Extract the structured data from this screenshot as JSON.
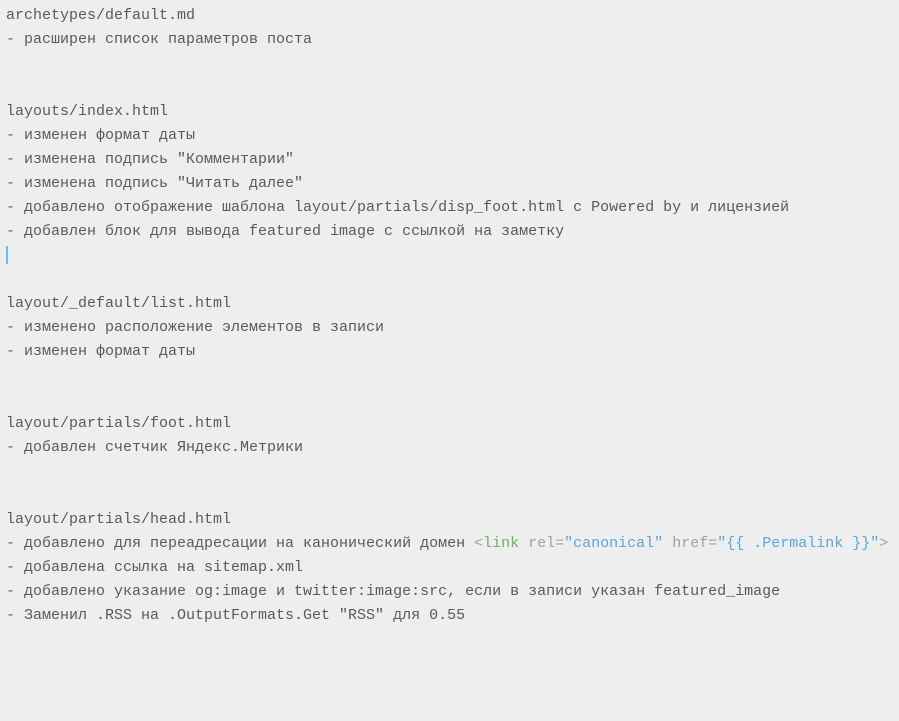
{
  "sections": [
    {
      "header": "archetypes/default.md",
      "items": [
        "- расширен список параметров поста"
      ]
    },
    {
      "header": "layouts/index.html",
      "items": [
        "- изменен формат даты",
        "- изменена подпись \"Комментарии\"",
        "- изменена подпись \"Читать далее\"",
        "- добавлено отображение шаблона layout/partials/disp_foot.html с Powered by и лицензией",
        "- добавлен блок для вывода featured image с ссылкой на заметку"
      ],
      "cursor_after": true
    },
    {
      "header": "layout/_default/list.html",
      "items": [
        "- изменено расположение элементов в записи",
        "- изменен формат даты"
      ]
    },
    {
      "header": "layout/partials/foot.html",
      "items": [
        "- добавлен счетчик Яндекс.Метрики"
      ]
    },
    {
      "header": "layout/partials/head.html",
      "items_mixed": [
        {
          "prefix": "- добавлено для переадресации на канонический домен ",
          "html_snippet": {
            "open": "<",
            "tag": "link",
            "attrs": [
              {
                "name": "rel",
                "eq": "=",
                "q1": "\"",
                "value": "canonical",
                "q2": "\""
              },
              {
                "name": "href",
                "eq": "=",
                "q1": "\"",
                "value": "{{ .Permalink }}",
                "q2": "\""
              }
            ],
            "close": ">"
          }
        },
        {
          "text": "- добавлена ссылка на sitemap.xml"
        },
        {
          "text": "- добавлено указание og:image и twitter:image:src, если в записи указан featured_image"
        },
        {
          "text": "- Заменил .RSS на .OutputFormats.Get \"RSS\" для 0.55"
        }
      ]
    }
  ]
}
